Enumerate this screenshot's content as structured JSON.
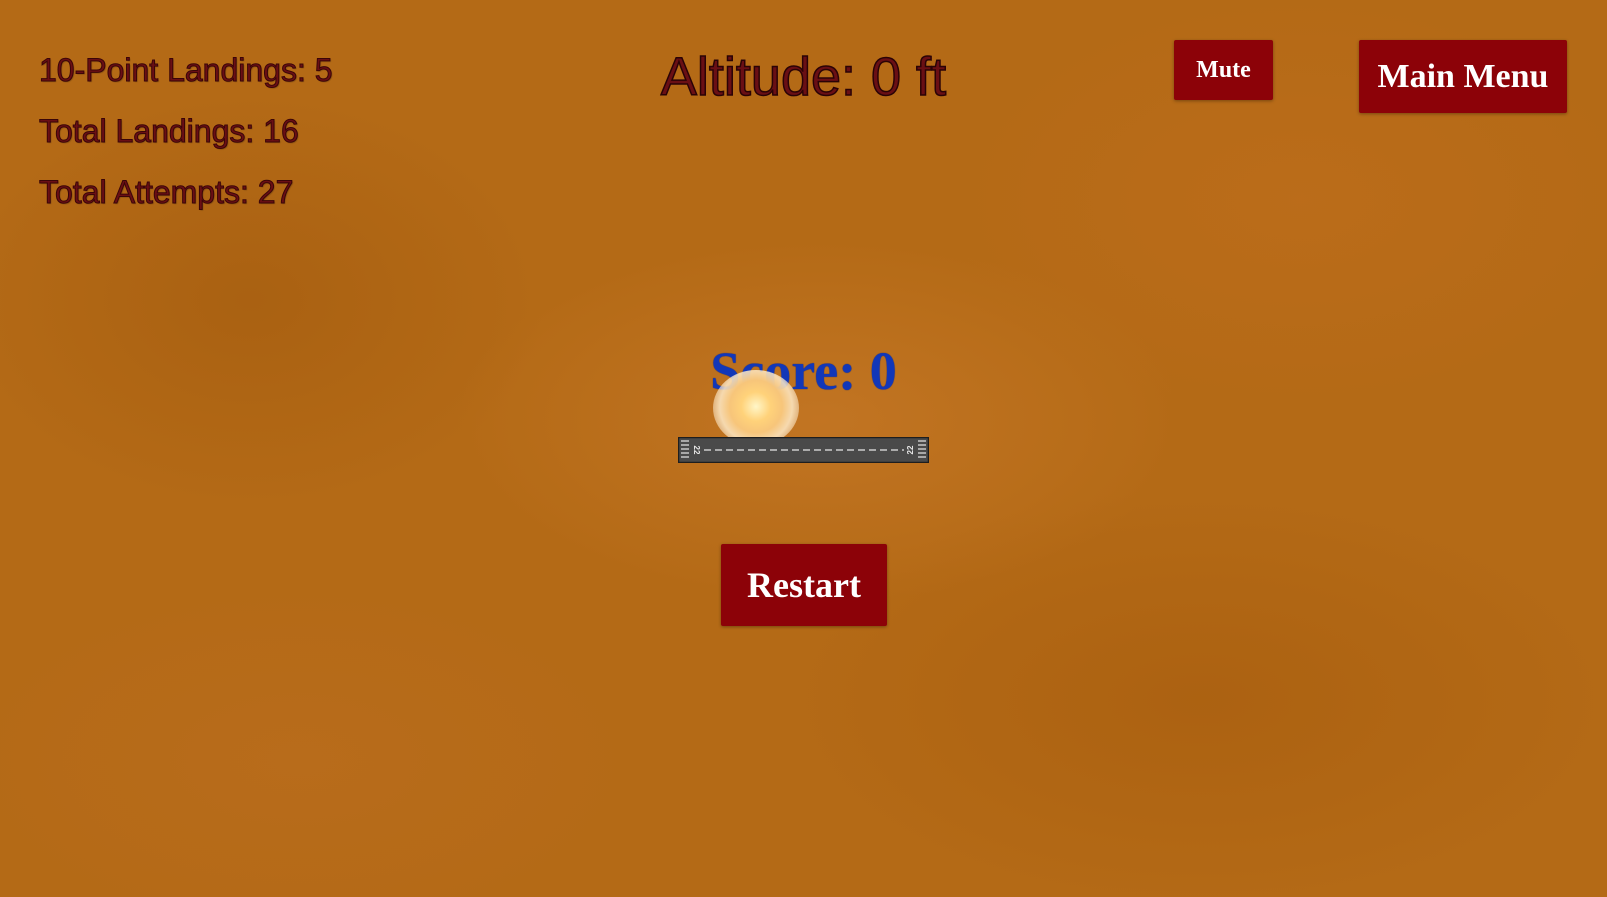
{
  "stats": {
    "ten_point_landings": "10-Point Landings: 5",
    "total_landings": "Total Landings: 16",
    "total_attempts": "Total Attempts: 27"
  },
  "altitude": "Altitude: 0 ft",
  "buttons": {
    "mute": "Mute",
    "main_menu": "Main Menu",
    "restart": "Restart"
  },
  "score": "Score: 0",
  "runway": {
    "left_number": "22",
    "right_number": "22"
  },
  "colors": {
    "background": "#b46a16",
    "stat_text": "#6a0f14",
    "button_bg": "#8c0208",
    "score_text": "#1237b8",
    "runway": "#4a4a4a"
  },
  "icons": {
    "explosion": "explosion-icon",
    "runway": "runway-icon"
  }
}
